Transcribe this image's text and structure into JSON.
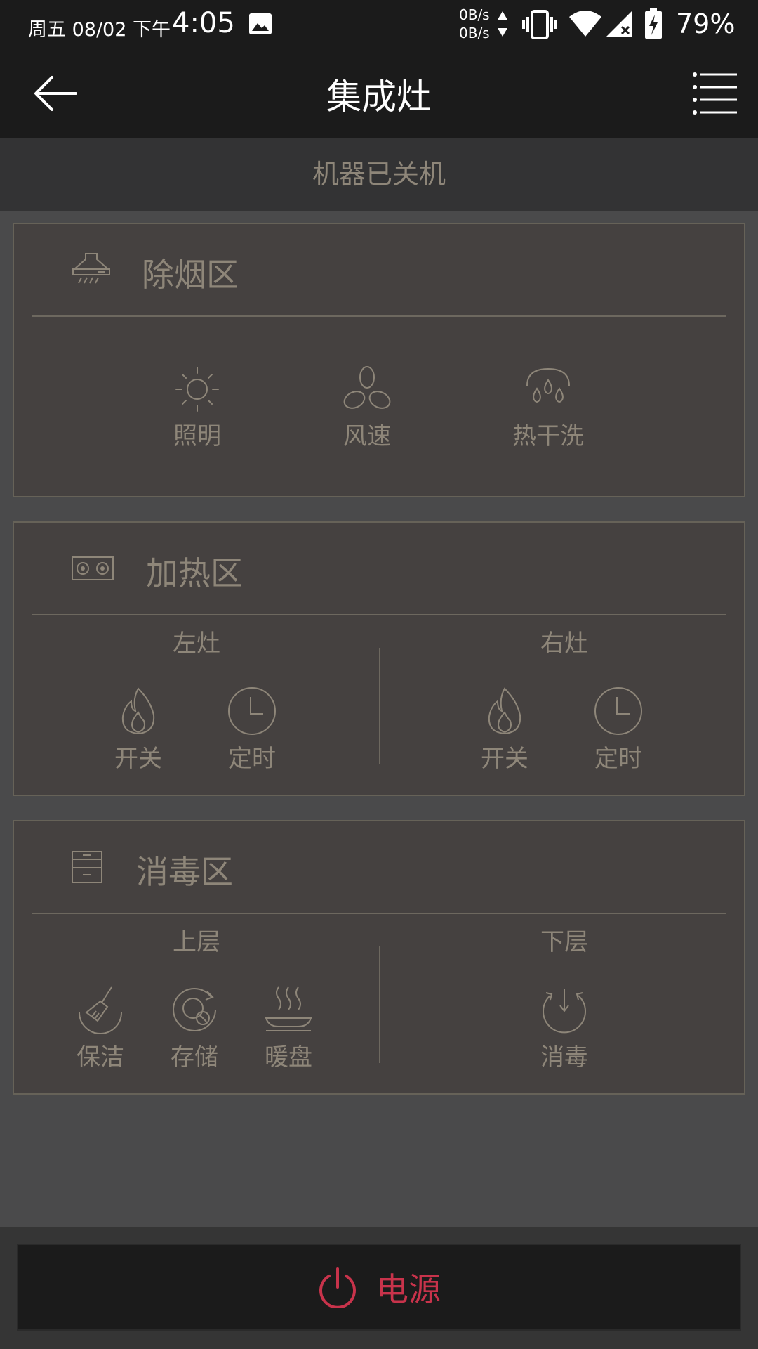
{
  "status_bar": {
    "date": "周五 08/02 下午",
    "time": "4:05",
    "net_up": "0B/s",
    "net_down": "0B/s",
    "battery": "79%"
  },
  "header": {
    "title": "集成灶"
  },
  "machine_status": "机器已关机",
  "hood": {
    "title": "除烟区",
    "controls": [
      "照明",
      "风速",
      "热干洗"
    ]
  },
  "heating": {
    "title": "加热区",
    "left_label": "左灶",
    "right_label": "右灶",
    "left_controls": [
      "开关",
      "定时"
    ],
    "right_controls": [
      "开关",
      "定时"
    ]
  },
  "disinfect": {
    "title": "消毒区",
    "upper_label": "上层",
    "lower_label": "下层",
    "upper_controls": [
      "保洁",
      "存储",
      "暖盘"
    ],
    "lower_controls": [
      "消毒"
    ]
  },
  "power": {
    "label": "电源"
  },
  "colors": {
    "accent_red": "#c8334b",
    "muted_text": "#8e8679",
    "panel_bg": "#454140"
  }
}
